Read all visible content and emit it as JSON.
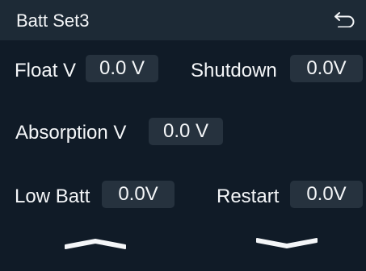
{
  "header": {
    "title": "Batt Set3",
    "back_icon": "return-arrow-icon"
  },
  "fields": {
    "float_v": {
      "label": "Float V",
      "value": "0.0 V"
    },
    "shutdown": {
      "label": "Shutdown",
      "value": "0.0V"
    },
    "absorption_v": {
      "label": "Absorption V",
      "value": "0.0 V"
    },
    "low_batt": {
      "label": "Low Batt",
      "value": "0.0V"
    },
    "restart": {
      "label": "Restart",
      "value": "0.0V"
    }
  },
  "navigation": {
    "up_icon": "chevron-up-icon",
    "down_icon": "chevron-down-icon"
  },
  "colors": {
    "background": "#101b27",
    "header": "#1d2a36",
    "value_box": "#26323e",
    "text": "#f4f6f8"
  }
}
